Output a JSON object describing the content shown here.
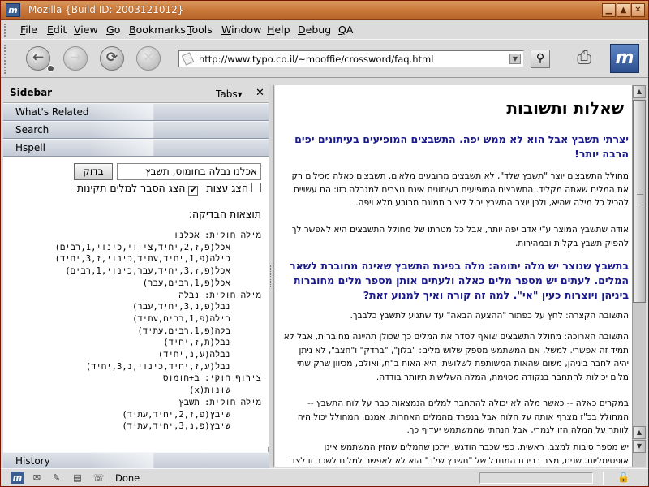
{
  "window": {
    "title": "Mozilla {Build ID: 2003121012}",
    "app_icon": "m",
    "buttons": [
      "minimize-icon",
      "maximize-icon",
      "close-icon"
    ]
  },
  "menubar": {
    "items": [
      "File",
      "Edit",
      "View",
      "Go",
      "Bookmarks",
      "Tools",
      "Window",
      "Help",
      "Debug",
      "QA"
    ]
  },
  "navigation": {
    "back_icon": "back-icon",
    "forward_icon": "forward-icon",
    "reload_icon": "reload-icon",
    "stop_icon": "stop-icon",
    "url": "http://www.typo.co.il/~mooffie/crossword/faq.html",
    "search_icon": "magnifier-icon",
    "print_icon": "print-icon",
    "throbber_label": "m"
  },
  "sidebar": {
    "title": "Sidebar",
    "tabs_label": "Tabs",
    "close_glyph": "✕",
    "panels": [
      "What's Related",
      "Search",
      "Hspell"
    ],
    "history_label": "History",
    "hspell": {
      "input_value": "אכלנו נבלה בחומוס, תשבץ",
      "button_label": "בדוק",
      "option_suggest": "הצג עצות",
      "option_explain": "הצג הסבר למלים תקינות",
      "option_suggest_checked": false,
      "option_explain_checked": true,
      "results_title": "תוצאות הבדיקה:",
      "results": [
        {
          "t": "מילה חוקית: אכלנו",
          "k": "h"
        },
        {
          "t": "אכל(פ,ז,2,יחיד,ציווי,כינוי,1,רבים)",
          "k": "i"
        },
        {
          "t": "כילה(פ,1,יחיד,עתיד,כינוי,ז,3,יחיד)",
          "k": "i"
        },
        {
          "t": "אכל(פ,ז,3,יחיד,עבר,כינוי,1,רבים)",
          "k": "i"
        },
        {
          "t": "אכל(פ,1,רבים,עבר)",
          "k": "i"
        },
        {
          "t": "מילה חוקית: נבלה",
          "k": "h"
        },
        {
          "t": "נבל(פ,נ,3,יחיד,עבר)",
          "k": "i"
        },
        {
          "t": "בילה(פ,1,רבים,עתיד)",
          "k": "i"
        },
        {
          "t": "בלה(פ,1,רבים,עתיד)",
          "k": "i"
        },
        {
          "t": "נבל(ת,ז,יחיד)",
          "k": "i"
        },
        {
          "t": "נבלה(ע,נ,יחיד)",
          "k": "i"
        },
        {
          "t": "נבל(ע,ז,יחיד,כינוי,נ,3,יחיד)",
          "k": "i"
        },
        {
          "t": "צירוף חוקי: ב+חומוס",
          "k": "h"
        },
        {
          "t": "שונות(x)",
          "k": "i"
        },
        {
          "t": "מילה חוקית: תשבץ",
          "k": "h"
        },
        {
          "t": "שיבץ(פ,ז,2,יחיד,עתיד)",
          "k": "i"
        },
        {
          "t": "שיבץ(פ,נ,3,יחיד,עתיד)",
          "k": "i"
        }
      ]
    }
  },
  "content": {
    "heading": "שאלות ותשובות",
    "q1": "יצרתי תשבץ אבל הוא לא ממש יפה. התשבצים המופיעים בעיתונים יפים הרבה יותר!",
    "p1": "מחולל התשבצים יוצר \"תשבץ שלד\", לא תשבצים מרובעים מלאים. תשבצים כאלה מכילים רק את המלים שאתה מקליד. התשבצים המופיעים בעיתונים אינם נוצרים למגבלה כזו: הם עשויים להכיל כל מילה שהיא, ולכן יוצר התשבץ יכול ליצור תמונת מרובע מלא ויפה.",
    "p2": "אודה שתשבץ המוצר ע\"י אדם יפה יותר, אבל כל מטרתו של מחולל התשבצים היא לאפשר לך להפיק תשבץ בקלות ובמהירות.",
    "q2": "בתשבץ שנוצר יש מלה יתומה: מלה בפינת התשבץ שאינה מחוברת לשאר המלים. לעתים יש מספר מלים כאלה ולעתים אותן מספר מלים מחוברות ביניהן ויוצרות כעין \"אי\". למה זה קורה ואיך למנוע זאת?",
    "p3": "התשובה הקצרה: לחץ על כפתור \"ההצעה הבאה\" עד שתגיע לתשבץ כלבבך.",
    "p4": "התשובה הארוכה: מחולל התשבצים שואף לסדר את המלים כך שכולן תהיינה מחוברות, אבל לא תמיד זה אפשרי. למשל, אם המשתמש מספק שלוש מלים: \"בלון\", \"ברדק\" ו\"חצב\", לא ניתן יהיה לחבר ביניהן, משום שהאות המשותפת לשלושתן היא האות ב\"ת, ואולם, מכיוון שרק שתי מלים יכולות להתחבר בנקודה מסוימת, המלה השלישית תיוותר בודדה.",
    "p5": "במקרים כאלה -- כאשר מלה לא יכולה להתחבר למלים הנמצאות כבר על לוח התשבץ -- המחולל בכ\"ז מצרף אותה על הלוח אבל בנפרד מהמלים האחרות. אמנם, המחולל יכול היה לוותר על המלה הזו לגמרי, אבל הנחתי שהמשתמש יעדיף כך.",
    "p6": "יש מספר סיבות למצב. ראשית, כפי שכבר הודגש, ייתכן שהמלים שהזין המשתמש אינן אופטימליות. שנית, מצב ברירת המחדל של \"תשבץ שלד\" הוא לא לאפשר למלים לשכב זו לצד זו, משום שזו ההתנהגות הרצויה ברוב המקרים. לבסוף, הרצת \"הצעה הבאה\" מספר פעמים"
  },
  "statusbar": {
    "status": "Done",
    "icons": [
      "mozilla-icon",
      "mail-icon",
      "composer-icon",
      "address-book-icon",
      "irc-icon"
    ],
    "lock_icon": "lock-icon"
  }
}
